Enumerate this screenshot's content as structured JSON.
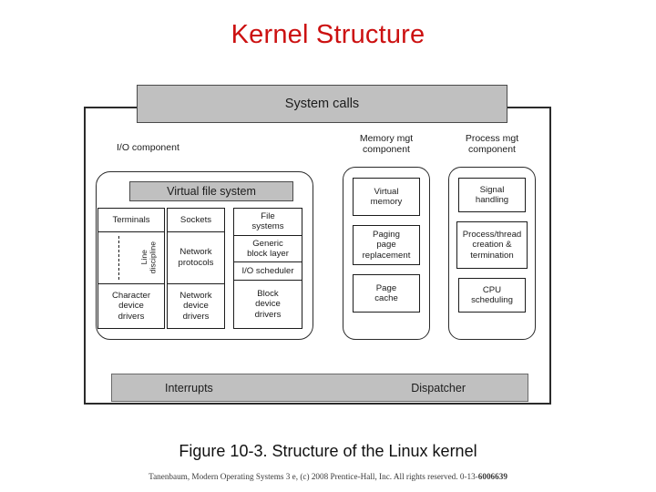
{
  "slide": {
    "title": "Kernel Structure",
    "title_color": "#cc1111",
    "background": "#ffffff"
  },
  "figure": {
    "system_calls_bar": "System calls",
    "bottom_bar": {
      "left_label": "Interrupts",
      "right_label": "Dispatcher"
    },
    "gray_fill": "#c0c0c0",
    "line_color": "#1c1c1c",
    "components": {
      "io": {
        "caption": "I/O component",
        "vfs_bar": "Virtual file system",
        "columns": [
          {
            "name": "terminal-column",
            "cells": [
              "Terminals",
              "Line\ndiscipline",
              "Character\ndevice\ndrivers"
            ]
          },
          {
            "name": "network-column",
            "cells": [
              "Sockets",
              "Network\nprotocols",
              "Network\ndevice\ndrivers"
            ]
          },
          {
            "name": "block-column",
            "cells": [
              "File\nsystems",
              "Generic\nblock layer",
              "I/O scheduler",
              "Block\ndevice\ndrivers"
            ]
          }
        ]
      },
      "memory": {
        "caption": "Memory mgt\ncomponent",
        "boxes": [
          "Virtual\nmemory",
          "Paging\npage\nreplacement",
          "Page\ncache"
        ]
      },
      "process": {
        "caption": "Process mgt\ncomponent",
        "boxes": [
          "Signal\nhandling",
          "Process/thread\ncreation &\ntermination",
          "CPU\nscheduling"
        ]
      }
    }
  },
  "caption": "Figure 10-3. Structure of the Linux kernel",
  "copyright": {
    "text": "Tanenbaum, Modern Operating Systems 3 e, (c) 2008 Prentice-Hall, Inc. All rights reserved. 0-13-",
    "isbn": "6006639"
  }
}
